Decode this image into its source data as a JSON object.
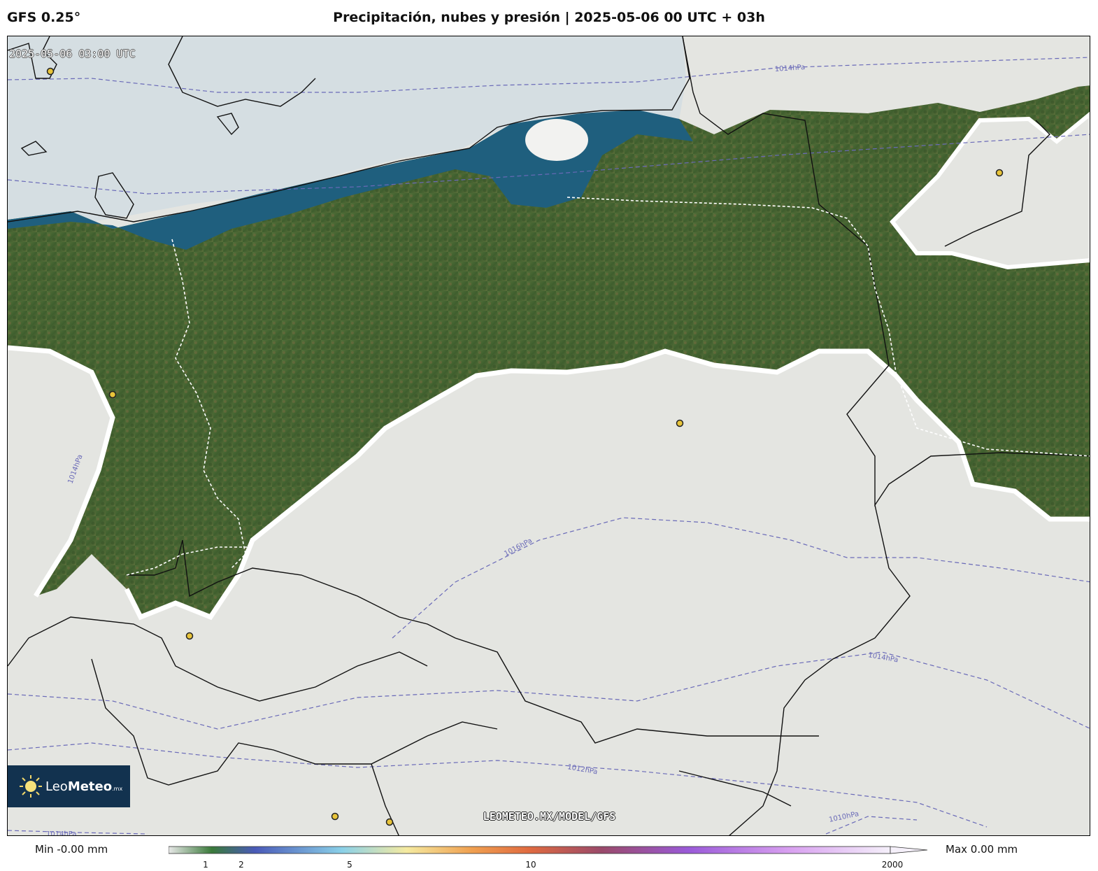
{
  "header": {
    "model": "GFS 0.25°",
    "title": "Precipitación, nubes y presión | 2025-05-06 00 UTC + 03h"
  },
  "map": {
    "timestamp": "2025-05-06 03:00 UTC",
    "site": "LEOMETEO.MX/MODEL/GFS",
    "isobar_labels": [
      "1014hPa",
      "1016hPa",
      "1014hPa",
      "1012hPa",
      "1010hPa",
      "1014hPa",
      "1014hPa"
    ],
    "colors": {
      "sea": "#d6dfe3",
      "cloud": "#e6e6e2",
      "land": "#4c6a35",
      "rain_band": "#1f5f7e",
      "isobar": "#6a6ab8",
      "city": "#e8c43a"
    }
  },
  "logo": {
    "name_light": "Leo",
    "name_bold": "Meteo",
    "suffix": ".mx"
  },
  "colorbar": {
    "min_label": "Min -0.00 mm",
    "max_label": "Max 0.00 mm",
    "ticks": [
      "1",
      "2",
      "5",
      "10",
      "2000"
    ],
    "colors": [
      "#e8e8e8",
      "#3a7a3a",
      "#4a5ab8",
      "#8ad0e8",
      "#f5eaa0",
      "#f0a050",
      "#e06a40",
      "#9a4a6a",
      "#9a5ad8",
      "#d8a0f0",
      "#f5f0fa"
    ]
  }
}
